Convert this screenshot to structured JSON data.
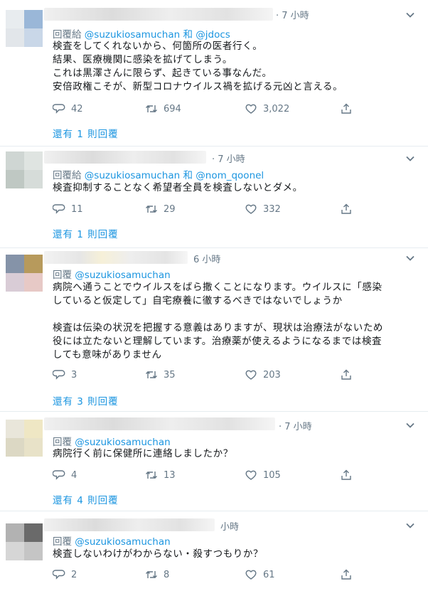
{
  "tweets": [
    {
      "time": "· 7 小時",
      "reply_prefix": "回覆給",
      "reply_handles": "@suzukiosamuchan 和 @jdocs",
      "lines": [
        "検査をしてくれないから、何箇所の医者行く。",
        "結果、医療機関に感染を拡げてしまう。",
        "これは黒澤さんに限らず、起きている事なんだ。",
        "安倍政権こそが、新型コロナウイルス禍を拡げる元凶と言える。"
      ],
      "replies": "42",
      "retweets": "694",
      "likes": "3,022",
      "more_replies": "還有 1 則回覆",
      "avatar_colors": [
        "#e8ecef",
        "#9ab7d8",
        "#e2e6ea",
        "#c9d7e8"
      ]
    },
    {
      "time": "· 7 小時",
      "reply_prefix": "回覆給",
      "reply_handles": "@suzukiosamuchan 和 @nom_qoonel",
      "lines": [
        "検査抑制することなく希望者全員を検査しないとダメ。"
      ],
      "replies": "11",
      "retweets": "29",
      "likes": "332",
      "more_replies": "還有 1 則回覆",
      "avatar_colors": [
        "#cfd6d3",
        "#dfe4e1",
        "#bfc8c3",
        "#d6dcd9"
      ]
    },
    {
      "time": "6 小時",
      "reply_prefix": "回覆",
      "reply_handles": "@suzukiosamuchan",
      "lines": [
        "病院へ通うことでウイルスをばら撒くことになります。ウイルスに「感染",
        "していると仮定して」自宅療養に徹するべきではないでしょうか",
        "",
        "検査は伝染の状況を把握する意義はありますが、現状は治療法がないため",
        "役には立たないと理解しています。治療薬が使えるようになるまでは検査",
        "しても意味がありません"
      ],
      "replies": "3",
      "retweets": "35",
      "likes": "203",
      "more_replies": "還有 3 則回覆",
      "avatar_colors": [
        "#8593a8",
        "#b79a5c",
        "#d9ccd6",
        "#e7c9c6"
      ]
    },
    {
      "time": "· 7 小時",
      "reply_prefix": "回覆",
      "reply_handles": "@suzukiosamuchan",
      "lines": [
        "病院行く前に保健所に連絡しましたか？"
      ],
      "replies": "4",
      "retweets": "13",
      "likes": "105",
      "more_replies": "還有 4 則回覆",
      "avatar_colors": [
        "#e9e6da",
        "#efe7c4",
        "#dcd8c4",
        "#e8e2c8"
      ]
    },
    {
      "time": "小時",
      "reply_prefix": "回覆",
      "reply_handles": "@suzukiosamuchan",
      "lines": [
        "検査しないわけがわからない・殺すつもりか？"
      ],
      "replies": "2",
      "retweets": "8",
      "likes": "61",
      "more_replies": "",
      "avatar_colors": [
        "#b2b2b2",
        "#6a6a6a",
        "#d6d6d6",
        "#c5c5c5"
      ]
    }
  ]
}
